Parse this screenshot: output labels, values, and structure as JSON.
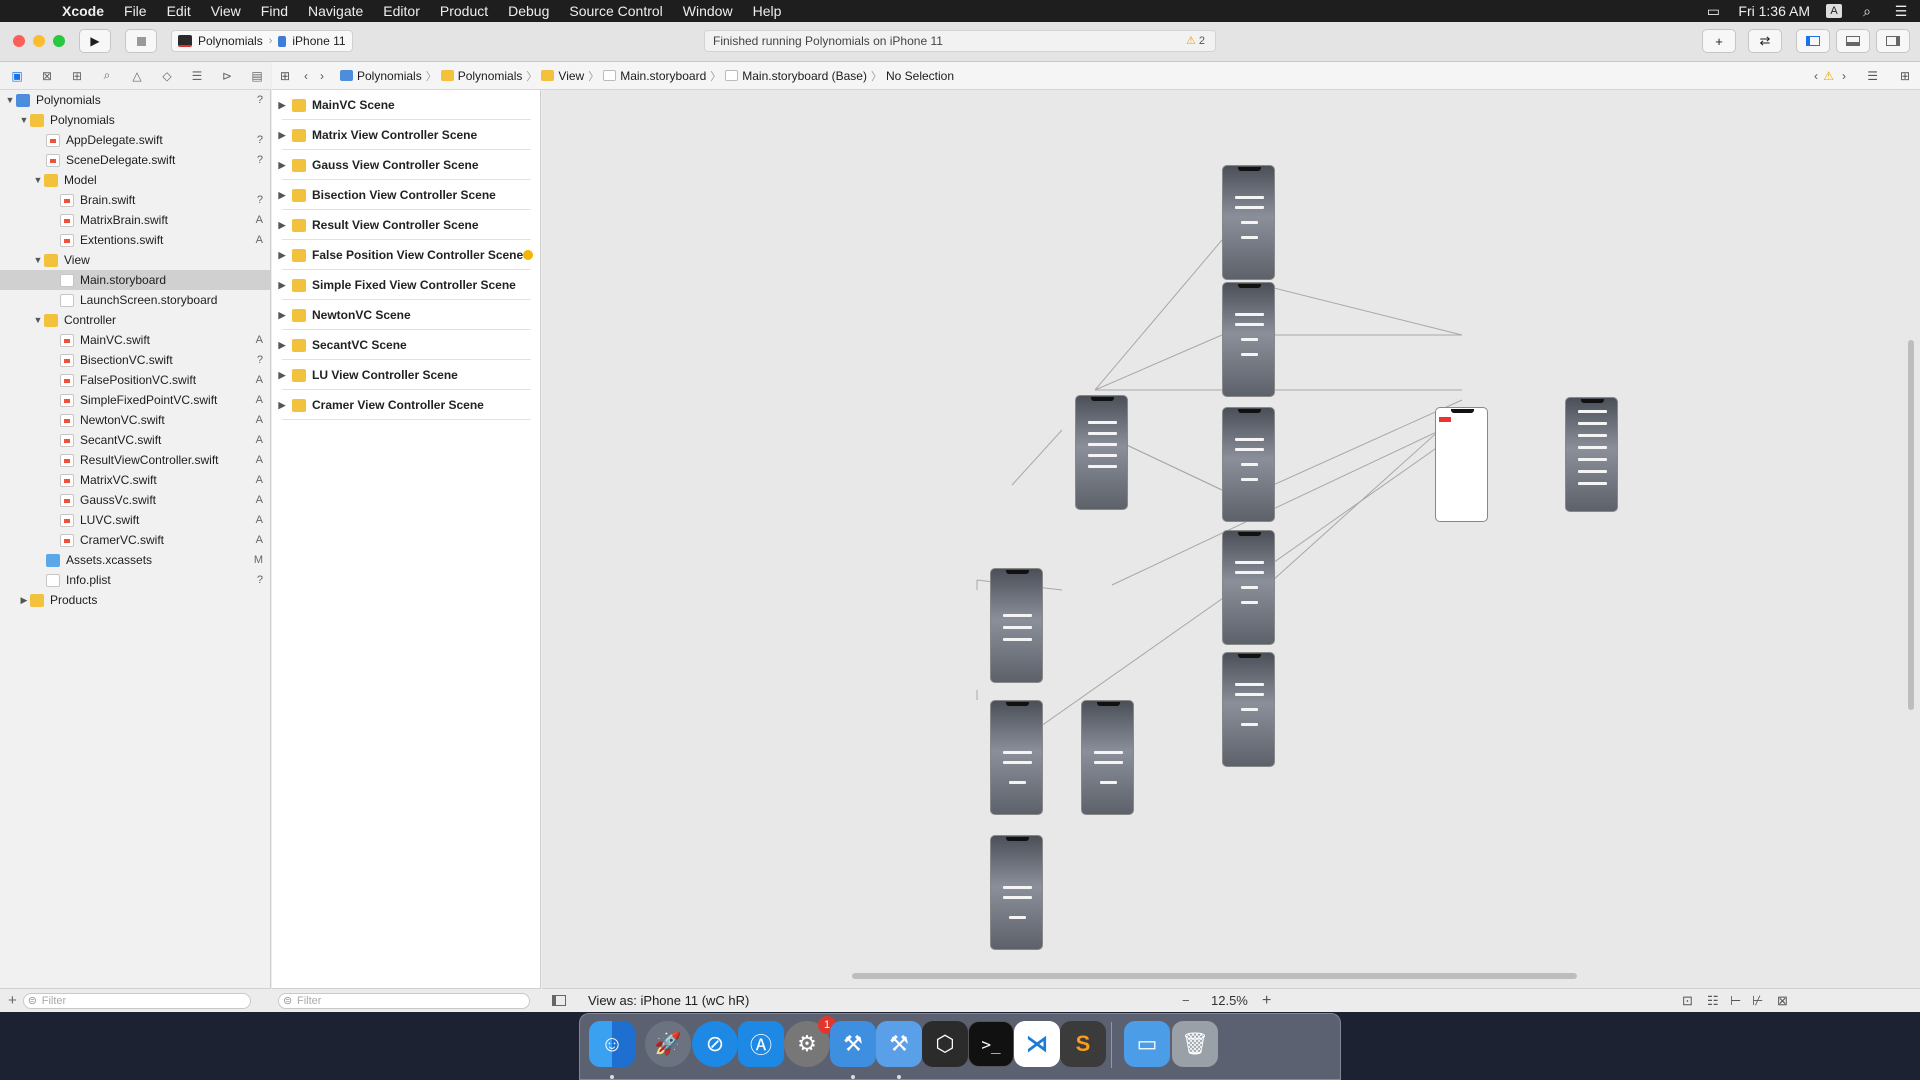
{
  "menubar": {
    "app": "Xcode",
    "items": [
      "File",
      "Edit",
      "View",
      "Find",
      "Navigate",
      "Editor",
      "Product",
      "Debug",
      "Source Control",
      "Window",
      "Help"
    ],
    "clock": "Fri 1:36 AM",
    "input_source": "A"
  },
  "toolbar": {
    "scheme": "Polynomials",
    "destination": "iPhone 11",
    "activity": "Finished running Polynomials on iPhone 11",
    "warnings": "2"
  },
  "navigator": {
    "rows": [
      {
        "label": "Polynomials",
        "status": "?",
        "icon": "project",
        "level": 0,
        "disclosure": "▼"
      },
      {
        "label": "Polynomials",
        "status": "",
        "icon": "folder",
        "level": 1,
        "disclosure": "▼"
      },
      {
        "label": "AppDelegate.swift",
        "status": "?",
        "icon": "swift",
        "level": 2,
        "disclosure": ""
      },
      {
        "label": "SceneDelegate.swift",
        "status": "?",
        "icon": "swift",
        "level": 2,
        "disclosure": ""
      },
      {
        "label": "Model",
        "status": "",
        "icon": "folder",
        "level": 2,
        "disclosure": "▼"
      },
      {
        "label": "Brain.swift",
        "status": "?",
        "icon": "swift",
        "level": 3,
        "disclosure": ""
      },
      {
        "label": "MatrixBrain.swift",
        "status": "A",
        "icon": "swift",
        "level": 3,
        "disclosure": ""
      },
      {
        "label": "Extentions.swift",
        "status": "A",
        "icon": "swift",
        "level": 3,
        "disclosure": ""
      },
      {
        "label": "View",
        "status": "",
        "icon": "folder",
        "level": 2,
        "disclosure": "▼"
      },
      {
        "label": "Main.storyboard",
        "status": "",
        "icon": "storyboard",
        "level": 3,
        "disclosure": "",
        "selected": true
      },
      {
        "label": "LaunchScreen.storyboard",
        "status": "",
        "icon": "storyboard",
        "level": 3,
        "disclosure": ""
      },
      {
        "label": "Controller",
        "status": "",
        "icon": "folder",
        "level": 2,
        "disclosure": "▼"
      },
      {
        "label": "MainVC.swift",
        "status": "A",
        "icon": "swift",
        "level": 3,
        "disclosure": ""
      },
      {
        "label": "BisectionVC.swift",
        "status": "?",
        "icon": "swift",
        "level": 3,
        "disclosure": ""
      },
      {
        "label": "FalsePositionVC.swift",
        "status": "A",
        "icon": "swift",
        "level": 3,
        "disclosure": ""
      },
      {
        "label": "SimpleFixedPointVC.swift",
        "status": "A",
        "icon": "swift",
        "level": 3,
        "disclosure": ""
      },
      {
        "label": "NewtonVC.swift",
        "status": "A",
        "icon": "swift",
        "level": 3,
        "disclosure": ""
      },
      {
        "label": "SecantVC.swift",
        "status": "A",
        "icon": "swift",
        "level": 3,
        "disclosure": ""
      },
      {
        "label": "ResultViewController.swift",
        "status": "A",
        "icon": "swift",
        "level": 3,
        "disclosure": ""
      },
      {
        "label": "MatrixVC.swift",
        "status": "A",
        "icon": "swift",
        "level": 3,
        "disclosure": ""
      },
      {
        "label": "GaussVc.swift",
        "status": "A",
        "icon": "swift",
        "level": 3,
        "disclosure": ""
      },
      {
        "label": "LUVC.swift",
        "status": "A",
        "icon": "swift",
        "level": 3,
        "disclosure": ""
      },
      {
        "label": "CramerVC.swift",
        "status": "A",
        "icon": "swift",
        "level": 3,
        "disclosure": ""
      },
      {
        "label": "Assets.xcassets",
        "status": "M",
        "icon": "assets",
        "level": 2,
        "disclosure": ""
      },
      {
        "label": "Info.plist",
        "status": "?",
        "icon": "plist",
        "level": 2,
        "disclosure": ""
      },
      {
        "label": "Products",
        "status": "",
        "icon": "folder",
        "level": 1,
        "disclosure": "▶"
      }
    ],
    "filter_placeholder": "Filter"
  },
  "jumpbar": {
    "crumbs": [
      "Polynomials",
      "Polynomials",
      "View",
      "Main.storyboard",
      "Main.storyboard (Base)",
      "No Selection"
    ]
  },
  "outline": {
    "scenes": [
      {
        "label": "MainVC Scene",
        "warning": false
      },
      {
        "label": "Matrix View Controller Scene",
        "warning": false
      },
      {
        "label": "Gauss View Controller Scene",
        "warning": false
      },
      {
        "label": "Bisection View Controller Scene",
        "warning": false
      },
      {
        "label": "Result View Controller Scene",
        "warning": false
      },
      {
        "label": "False Position View Controller Scene",
        "warning": true
      },
      {
        "label": "Simple Fixed View Controller Scene",
        "warning": false
      },
      {
        "label": "NewtonVC Scene",
        "warning": false
      },
      {
        "label": "SecantVC Scene",
        "warning": false
      },
      {
        "label": "LU View Controller Scene",
        "warning": false
      },
      {
        "label": "Cramer View Controller Scene",
        "warning": false
      }
    ],
    "filter_placeholder": "Filter"
  },
  "canvas": {
    "view_as": "View as: iPhone 11 (wC hR)",
    "zoom": "12.5%"
  },
  "dock": {
    "apps": [
      "Finder",
      "Launchpad",
      "Safari",
      "App Store",
      "System Preferences",
      "Xcode",
      "Xcode Beta",
      "Simulator Tool",
      "Terminal",
      "VS Code",
      "Sublime Text",
      "Downloads",
      "Trash"
    ],
    "sysprefs_badge": "1"
  },
  "colors": {
    "accent": "#1a73e8",
    "folder": "#f2c23c",
    "warning": "#f4b400"
  }
}
